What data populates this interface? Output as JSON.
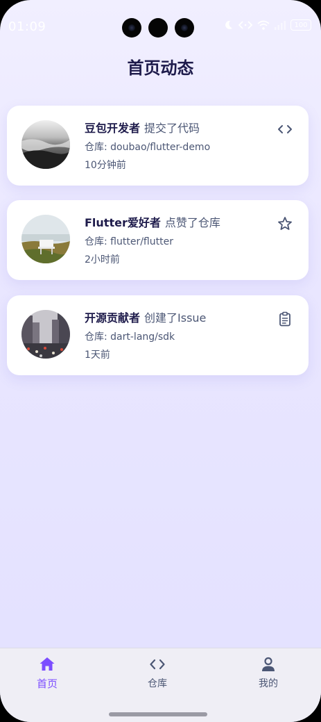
{
  "status_bar": {
    "time": "01:09",
    "battery": "100"
  },
  "header": {
    "title": "首页动态"
  },
  "feed": [
    {
      "user": "豆包开发者",
      "action": "提交了代码",
      "repo": "仓库: doubao/flutter-demo",
      "time": "10分钟前",
      "icon": "code-icon"
    },
    {
      "user": "Flutter爱好者",
      "action": "点赞了仓库",
      "repo": "仓库: flutter/flutter",
      "time": "2小时前",
      "icon": "star-icon"
    },
    {
      "user": "开源贡献者",
      "action": "创建了Issue",
      "repo": "仓库: dart-lang/sdk",
      "time": "1天前",
      "icon": "clipboard-icon"
    }
  ],
  "bottom_nav": {
    "items": [
      {
        "label": "首页",
        "icon": "home-icon",
        "active": true
      },
      {
        "label": "仓库",
        "icon": "code-icon",
        "active": false
      },
      {
        "label": "我的",
        "icon": "person-icon",
        "active": false
      }
    ]
  },
  "colors": {
    "accent": "#7c4dff",
    "title": "#1e1b4b",
    "secondary_text": "#4b5674",
    "background_top": "#f1efff",
    "background_bottom": "#e3e1ff"
  }
}
